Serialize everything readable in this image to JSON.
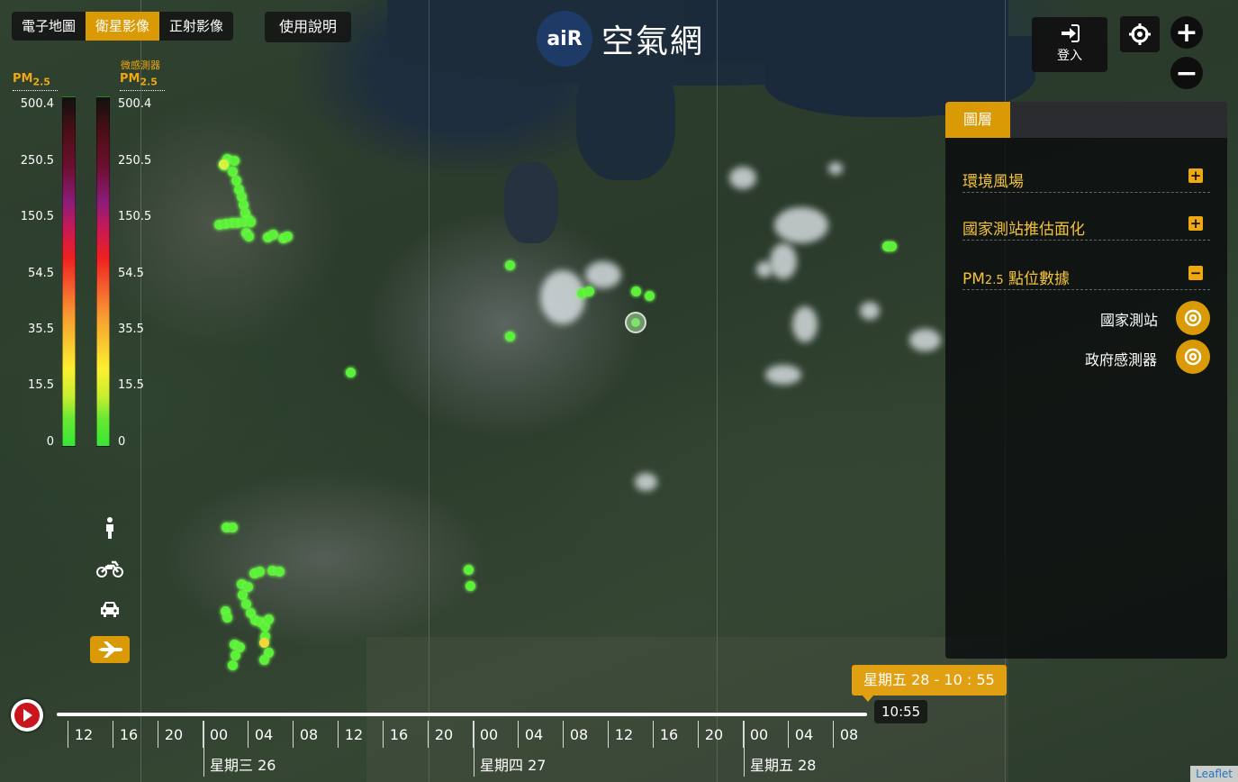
{
  "tabs": [
    {
      "label": "電子地圖",
      "active": false
    },
    {
      "label": "衛星影像",
      "active": true
    },
    {
      "label": "正射影像",
      "active": false
    }
  ],
  "help_label": "使用說明",
  "logo": {
    "icon_text": "aiR",
    "title": "空氣網"
  },
  "login_label": "登入",
  "zoom": {
    "in": "+",
    "out": "−"
  },
  "legend": {
    "left_title": "PM",
    "left_sub": "2.5",
    "right_caption": "微感測器",
    "right_title": "PM",
    "right_sub": "2.5",
    "ticks": [
      "500.4",
      "250.5",
      "150.5",
      "54.5",
      "35.5",
      "15.5",
      "0"
    ]
  },
  "transport_icons": [
    "walk-icon",
    "motorcycle-icon",
    "car-icon",
    "airplane-icon"
  ],
  "layer_panel": {
    "tab_label": "圖層",
    "rows": [
      {
        "label": "環境風場",
        "toggle": "+"
      },
      {
        "label": "國家測站推估面化",
        "toggle": "+"
      },
      {
        "label_main": "PM",
        "label_sub": "2.5",
        "label_rest": " 點位數據",
        "toggle": "−"
      }
    ],
    "sublayers": [
      {
        "label": "國家測站"
      },
      {
        "label": "政府感測器"
      }
    ]
  },
  "timeline": {
    "hour_labels": [
      "12",
      "16",
      "20",
      "00",
      "04",
      "08",
      "12",
      "16",
      "20",
      "00",
      "04",
      "08",
      "12",
      "16",
      "20",
      "00",
      "04",
      "08"
    ],
    "day_labels": [
      "星期三 26",
      "星期四 27",
      "星期五 28"
    ],
    "current_badge": "星期五 28 - 10 : 55",
    "current_time": "10:55"
  },
  "attribution": "Leaflet"
}
